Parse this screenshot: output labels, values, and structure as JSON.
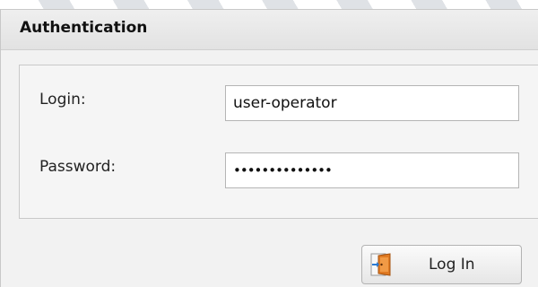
{
  "panel": {
    "title": "Authentication"
  },
  "form": {
    "login_label": "Login:",
    "login_value": "user-operator",
    "password_label": "Password:",
    "password_value": "••••••••••••••"
  },
  "actions": {
    "login_button_label": "Log In",
    "login_button_icon": "door-enter-icon"
  }
}
